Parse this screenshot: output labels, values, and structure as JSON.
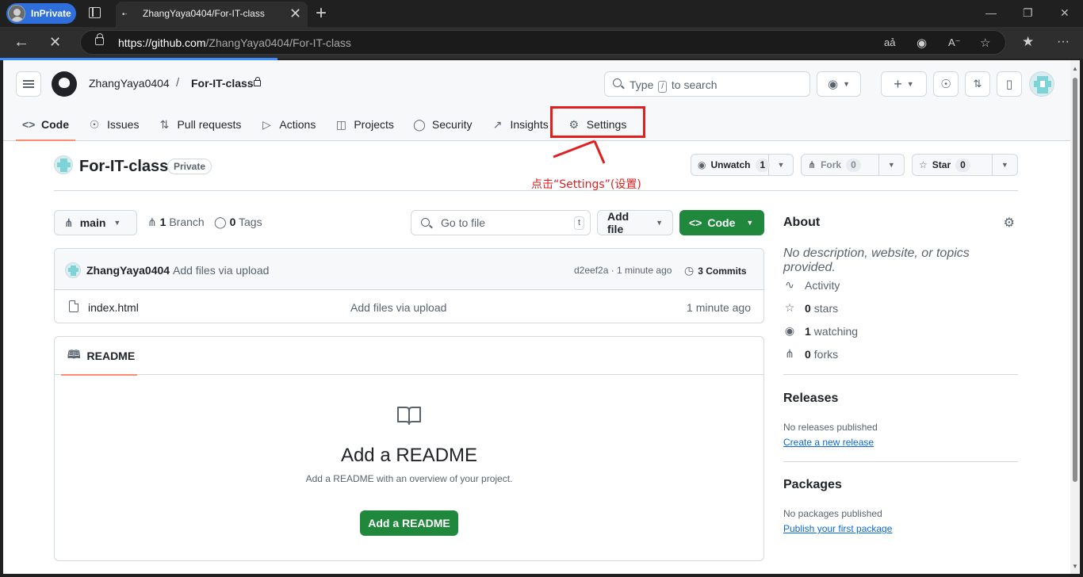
{
  "browser": {
    "inprivate_label": "InPrivate",
    "tab_title": "ZhangYaya0404/For-IT-class",
    "url_host": "https://github.com",
    "url_path": "/ZhangYaya0404/For-IT-class"
  },
  "header": {
    "owner": "ZhangYaya0404",
    "separator": "/",
    "repo": "For-IT-class",
    "search_pre": "Type",
    "search_key": "/",
    "search_post": "to search"
  },
  "reponav": [
    {
      "label": "Code",
      "icon": "code-icon"
    },
    {
      "label": "Issues",
      "icon": "issue-icon"
    },
    {
      "label": "Pull requests",
      "icon": "pull-request-icon"
    },
    {
      "label": "Actions",
      "icon": "play-icon"
    },
    {
      "label": "Projects",
      "icon": "table-icon"
    },
    {
      "label": "Security",
      "icon": "shield-icon"
    },
    {
      "label": "Insights",
      "icon": "graph-icon"
    },
    {
      "label": "Settings",
      "icon": "gear-icon"
    }
  ],
  "annotation": {
    "text": "点击“Settings”(设置)",
    "color": "#e02020"
  },
  "repo": {
    "name": "For-IT-class",
    "visibility": "Private",
    "watch_label": "Unwatch",
    "watch_count": "1",
    "fork_label": "Fork",
    "fork_count": "0",
    "star_label": "Star",
    "star_count": "0"
  },
  "toolbar": {
    "branch": "main",
    "branch_count": "1",
    "branch_word": "Branch",
    "tag_count": "0",
    "tag_word": "Tags",
    "gofile_placeholder": "Go to file",
    "gofile_key": "t",
    "addfile_label": "Add file",
    "code_label": "Code"
  },
  "commit": {
    "user": "ZhangYaya0404",
    "message": "Add files via upload",
    "hash_time": "d2eef2a · 1 minute ago",
    "commits_count": "3 Commits"
  },
  "files": [
    {
      "name": "index.html",
      "message": "Add files via upload",
      "time": "1 minute ago"
    }
  ],
  "readme": {
    "tab": "README",
    "heading": "Add a README",
    "description": "Add a README with an overview of your project.",
    "button": "Add a README"
  },
  "about": {
    "title": "About",
    "description": "No description, website, or topics provided.",
    "activity": "Activity",
    "stars_count": "0",
    "stars_word": "stars",
    "watching_count": "1",
    "watching_word": "watching",
    "forks_count": "0",
    "forks_word": "forks"
  },
  "releases": {
    "title": "Releases",
    "none": "No releases published",
    "link": "Create a new release"
  },
  "packages": {
    "title": "Packages",
    "none": "No packages published",
    "link": "Publish your first package"
  },
  "colors": {
    "accent_green": "#1f883d",
    "active_tab_underline": "#fd8c73",
    "link_blue": "#0969da",
    "annotation_red": "#e02020",
    "browser_inprivate": "#2f6fdc"
  }
}
